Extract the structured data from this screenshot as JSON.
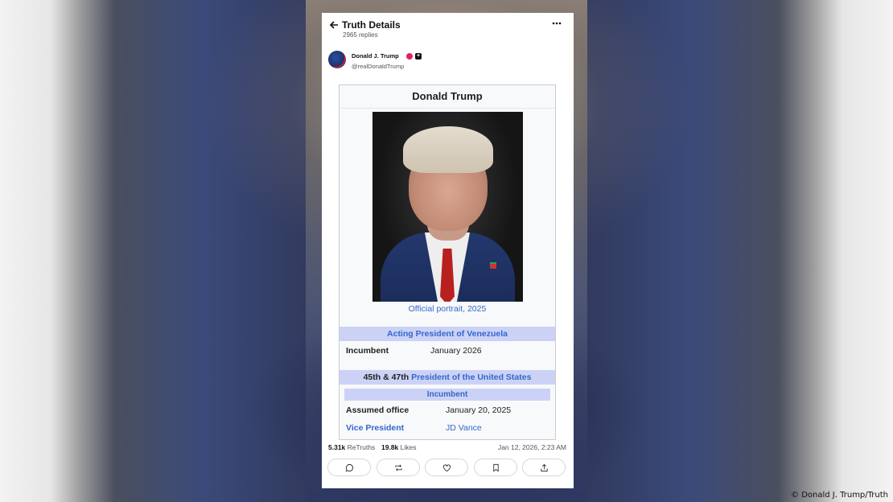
{
  "header": {
    "title": "Truth Details",
    "replies": "2965 replies"
  },
  "author": {
    "name": "Donald J. Trump",
    "handle": "@realDonaldTrump",
    "plus_glyph": "+"
  },
  "infobox": {
    "title": "Donald Trump",
    "portrait_caption": "Official portrait, 2025",
    "section1_title": "Acting President of Venezuela",
    "row1": {
      "label": "Incumbent",
      "value": "January 2026"
    },
    "section2_prefix": "45th & 47th ",
    "section2_link": "President of the United States",
    "subsection": "Incumbent",
    "row2": {
      "label": "Assumed office",
      "value": "January 20, 2025"
    },
    "row3": {
      "label": "Vice President",
      "value": "JD Vance"
    }
  },
  "stats": {
    "retruths_count": "5.31k",
    "retruths_label": "ReTruths",
    "likes_count": "19.8k",
    "likes_label": "Likes",
    "timestamp": "Jan 12, 2026, 2:23 AM"
  },
  "actions": [
    "reply-icon",
    "retruth-icon",
    "like-icon",
    "bookmark-icon",
    "share-icon"
  ],
  "credit": "© Donald J. Trump/Truth",
  "colors": {
    "link": "#3366cc",
    "section_bg": "#ccd2f6",
    "verified": "#e0245e"
  }
}
